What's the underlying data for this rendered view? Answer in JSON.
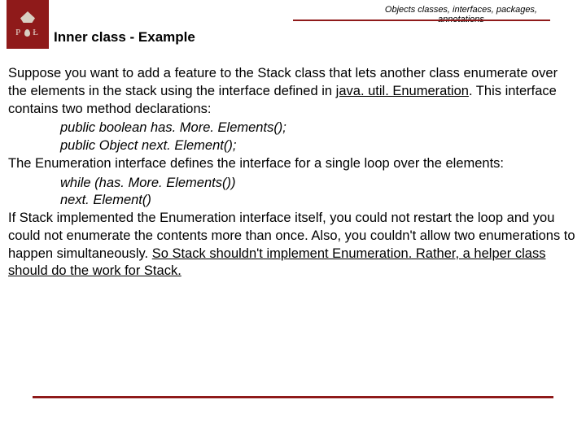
{
  "header": {
    "top_label_line1": "Objects classes, interfaces, packages,",
    "top_label_line2": "annotations",
    "title": "Inner class - Example",
    "logo_left": "P",
    "logo_right": "Ł"
  },
  "body": {
    "p1a": "Suppose you want to add a feature to the Stack class that lets another class enumerate over the elements in the stack using the interface defined in ",
    "p1b": "java. util. Enumeration",
    "p1c": ". This interface contains two method declarations:",
    "code1a": "public boolean has. More. Elements();",
    "code1b": "public Object next. Element();",
    "p2": "The Enumeration interface defines the interface for a single loop over the elements:",
    "code2a": "while (has. More. Elements())",
    "code2b": "next. Element()",
    "p3a": "If Stack implemented the Enumeration interface itself, you could not restart the loop and you could not enumerate the contents more than once. Also, you couldn't allow two enumerations to happen simultaneously. ",
    "p3b": "So Stack shouldn't implement Enumeration. Rather, a helper class should do the work for Stack."
  }
}
